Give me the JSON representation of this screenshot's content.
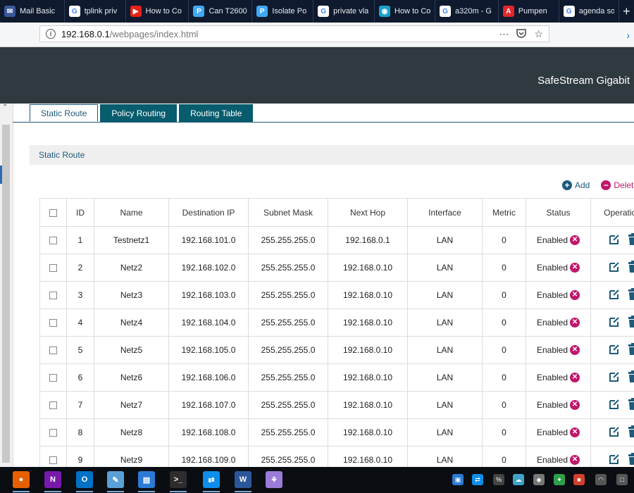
{
  "browser": {
    "tabs": [
      {
        "label": "Mail Basic",
        "icon": "mail-icon",
        "color": "#3b5998",
        "glyph": "✉"
      },
      {
        "label": "tplink priv",
        "icon": "google-icon",
        "color": "#ffffff",
        "glyph": "G"
      },
      {
        "label": "How to Co",
        "icon": "youtube-icon",
        "color": "#e62117",
        "glyph": "▶"
      },
      {
        "label": "Can T2600",
        "icon": "tplink-community-icon",
        "color": "#3fa9f5",
        "glyph": "P"
      },
      {
        "label": "Isolate Po",
        "icon": "tplink-community-icon",
        "color": "#3fa9f5",
        "glyph": "P"
      },
      {
        "label": "private vla",
        "icon": "google-icon",
        "color": "#ffffff",
        "glyph": "G"
      },
      {
        "label": "How to Co",
        "icon": "site-icon",
        "color": "#1aa3c7",
        "glyph": "◉"
      },
      {
        "label": "a320m - G",
        "icon": "google-icon",
        "color": "#ffffff",
        "glyph": "G"
      },
      {
        "label": "Pumpen",
        "icon": "adobe-icon",
        "color": "#e3252c",
        "glyph": "A"
      },
      {
        "label": "agenda so",
        "icon": "google-icon",
        "color": "#ffffff",
        "glyph": "G"
      }
    ],
    "url_host": "192.168.0.1",
    "url_path": "/webpages/index.html"
  },
  "header": {
    "product": "SafeStream Gigabit"
  },
  "tabs": [
    "Static Route",
    "Policy Routing",
    "Routing Table"
  ],
  "active_tab": 0,
  "section_title": "Static Route",
  "actions": {
    "add": "Add",
    "delete": "Delete"
  },
  "table": {
    "columns": [
      "ID",
      "Name",
      "Destination IP",
      "Subnet Mask",
      "Next Hop",
      "Interface",
      "Metric",
      "Status",
      "Operation"
    ],
    "rows": [
      {
        "id": "1",
        "name": "Testnetz1",
        "dest": "192.168.101.0",
        "mask": "255.255.255.0",
        "hop": "192.168.0.1",
        "iface": "LAN",
        "metric": "0",
        "status": "Enabled"
      },
      {
        "id": "2",
        "name": "Netz2",
        "dest": "192.168.102.0",
        "mask": "255.255.255.0",
        "hop": "192.168.0.10",
        "iface": "LAN",
        "metric": "0",
        "status": "Enabled"
      },
      {
        "id": "3",
        "name": "Netz3",
        "dest": "192.168.103.0",
        "mask": "255.255.255.0",
        "hop": "192.168.0.10",
        "iface": "LAN",
        "metric": "0",
        "status": "Enabled"
      },
      {
        "id": "4",
        "name": "Netz4",
        "dest": "192.168.104.0",
        "mask": "255.255.255.0",
        "hop": "192.168.0.10",
        "iface": "LAN",
        "metric": "0",
        "status": "Enabled"
      },
      {
        "id": "5",
        "name": "Netz5",
        "dest": "192.168.105.0",
        "mask": "255.255.255.0",
        "hop": "192.168.0.10",
        "iface": "LAN",
        "metric": "0",
        "status": "Enabled"
      },
      {
        "id": "6",
        "name": "Netz6",
        "dest": "192.168.106.0",
        "mask": "255.255.255.0",
        "hop": "192.168.0.10",
        "iface": "LAN",
        "metric": "0",
        "status": "Enabled"
      },
      {
        "id": "7",
        "name": "Netz7",
        "dest": "192.168.107.0",
        "mask": "255.255.255.0",
        "hop": "192.168.0.10",
        "iface": "LAN",
        "metric": "0",
        "status": "Enabled"
      },
      {
        "id": "8",
        "name": "Netz8",
        "dest": "192.168.108.0",
        "mask": "255.255.255.0",
        "hop": "192.168.0.10",
        "iface": "LAN",
        "metric": "0",
        "status": "Enabled"
      },
      {
        "id": "9",
        "name": "Netz9",
        "dest": "192.168.109.0",
        "mask": "255.255.255.0",
        "hop": "192.168.0.10",
        "iface": "LAN",
        "metric": "0",
        "status": "Enabled"
      }
    ]
  },
  "taskbar": {
    "apps": [
      {
        "name": "firefox-icon",
        "color": "#e66000",
        "glyph": "●",
        "running": true
      },
      {
        "name": "onenote-icon",
        "color": "#7719aa",
        "glyph": "N",
        "running": true
      },
      {
        "name": "outlook-icon",
        "color": "#0072c6",
        "glyph": "O",
        "running": true
      },
      {
        "name": "notepad-icon",
        "color": "#5aa0d8",
        "glyph": "✎",
        "running": true
      },
      {
        "name": "network-config-icon",
        "color": "#2b7bd6",
        "glyph": "▤",
        "running": true
      },
      {
        "name": "terminal-icon",
        "color": "#2d2d2d",
        "glyph": ">_",
        "running": true
      },
      {
        "name": "teamviewer-icon",
        "color": "#0e8ee9",
        "glyph": "⇄",
        "running": true
      },
      {
        "name": "word-icon",
        "color": "#2b579a",
        "glyph": "W",
        "running": true
      },
      {
        "name": "paint-icon",
        "color": "#9a7bd8",
        "glyph": "⚘",
        "running": false
      }
    ],
    "tray": [
      {
        "name": "tray-app-1-icon",
        "color": "#2b7bd6",
        "glyph": "▣"
      },
      {
        "name": "tray-teamviewer-icon",
        "color": "#0e8ee9",
        "glyph": "⇄"
      },
      {
        "name": "tray-app-3-icon",
        "color": "#444444",
        "glyph": "%"
      },
      {
        "name": "tray-network-icon",
        "color": "#3fa3c7",
        "glyph": "☁"
      },
      {
        "name": "tray-app-5-icon",
        "color": "#777777",
        "glyph": "◆"
      },
      {
        "name": "tray-security-icon",
        "color": "#2e9e4a",
        "glyph": "✦"
      },
      {
        "name": "tray-app-7-icon",
        "color": "#d23f2a",
        "glyph": "■"
      },
      {
        "name": "tray-wifi-icon",
        "color": "#555555",
        "glyph": "◠"
      },
      {
        "name": "tray-notification-icon",
        "color": "#555555",
        "glyph": "□"
      }
    ]
  }
}
